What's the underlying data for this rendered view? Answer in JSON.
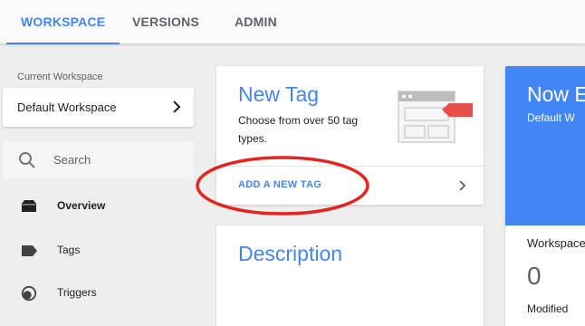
{
  "tabs": [
    {
      "label": "WORKSPACE",
      "active": true
    },
    {
      "label": "VERSIONS",
      "active": false
    },
    {
      "label": "ADMIN",
      "active": false
    }
  ],
  "sidebar": {
    "workspace_label": "Current Workspace",
    "workspace_name": "Default Workspace",
    "search_placeholder": "Search",
    "items": [
      {
        "label": "Overview",
        "icon": "overview-icon",
        "active": true
      },
      {
        "label": "Tags",
        "icon": "tag-icon",
        "active": false
      },
      {
        "label": "Triggers",
        "icon": "trigger-icon",
        "active": false
      }
    ]
  },
  "new_tag_card": {
    "title": "New Tag",
    "description": "Choose from over 50 tag types.",
    "action": "ADD A NEW TAG"
  },
  "description_card": {
    "title": "Description"
  },
  "now_editing_card": {
    "title": "Now E",
    "subtitle": "Default W"
  },
  "workspace_stats": {
    "label": "Workspace",
    "count": "0",
    "sub": "Modified"
  },
  "colors": {
    "accent": "#4285f4",
    "annotation": "#e8231f",
    "tag_red": "#e84f4b"
  }
}
